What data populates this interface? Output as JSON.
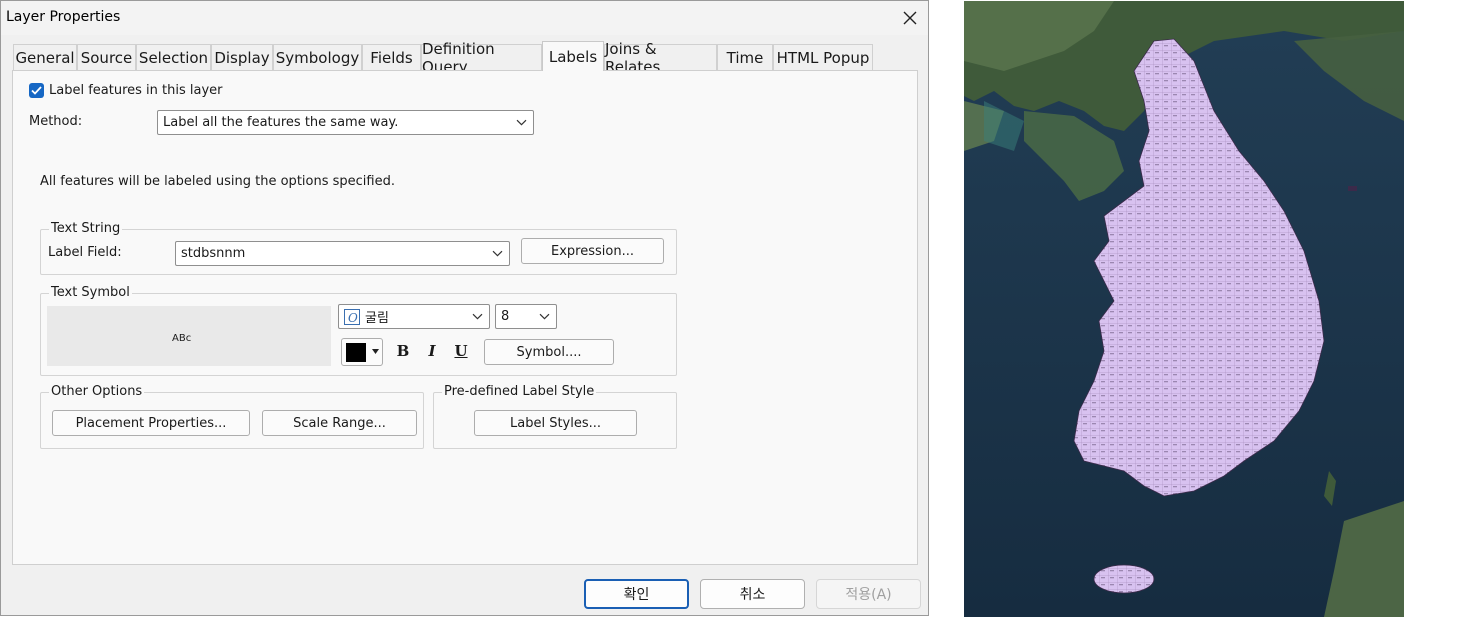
{
  "dialog": {
    "title": "Layer Properties",
    "tabs": [
      "General",
      "Source",
      "Selection",
      "Display",
      "Symbology",
      "Fields",
      "Definition Query",
      "Labels",
      "Joins & Relates",
      "Time",
      "HTML Popup"
    ],
    "active_tab": "Labels"
  },
  "labels_tab": {
    "label_features_checkbox": "Label features in this layer",
    "label_features_checked": true,
    "method_label": "Method:",
    "method_value": "Label all the features the same way.",
    "info_text": "All features will be labeled using the options specified.",
    "text_string": {
      "group_title": "Text String",
      "label_field_label": "Label Field:",
      "label_field_value": "stdbsnnm",
      "expression_button": "Expression..."
    },
    "text_symbol": {
      "group_title": "Text Symbol",
      "preview_text": "ABc",
      "font_value": "굴림",
      "size_value": "8",
      "color": "#000000",
      "bold": "B",
      "italic": "I",
      "underline": "U",
      "symbol_button": "Symbol...."
    },
    "other_options": {
      "group_title": "Other Options",
      "placement_button": "Placement Properties...",
      "scale_button": "Scale Range..."
    },
    "predefined": {
      "group_title": "Pre-defined Label Style",
      "label_styles_button": "Label Styles..."
    }
  },
  "footer": {
    "ok": "확인",
    "cancel": "취소",
    "apply": "적용(A)"
  },
  "colors": {
    "accent": "#1667c4",
    "polygon_fill": "#d8c2f0",
    "sea": "#1d3a52"
  },
  "icons": {
    "close": "close-icon",
    "dropdown": "chevron-down-icon",
    "check": "check-icon",
    "font_type": "opentype-font-icon"
  }
}
